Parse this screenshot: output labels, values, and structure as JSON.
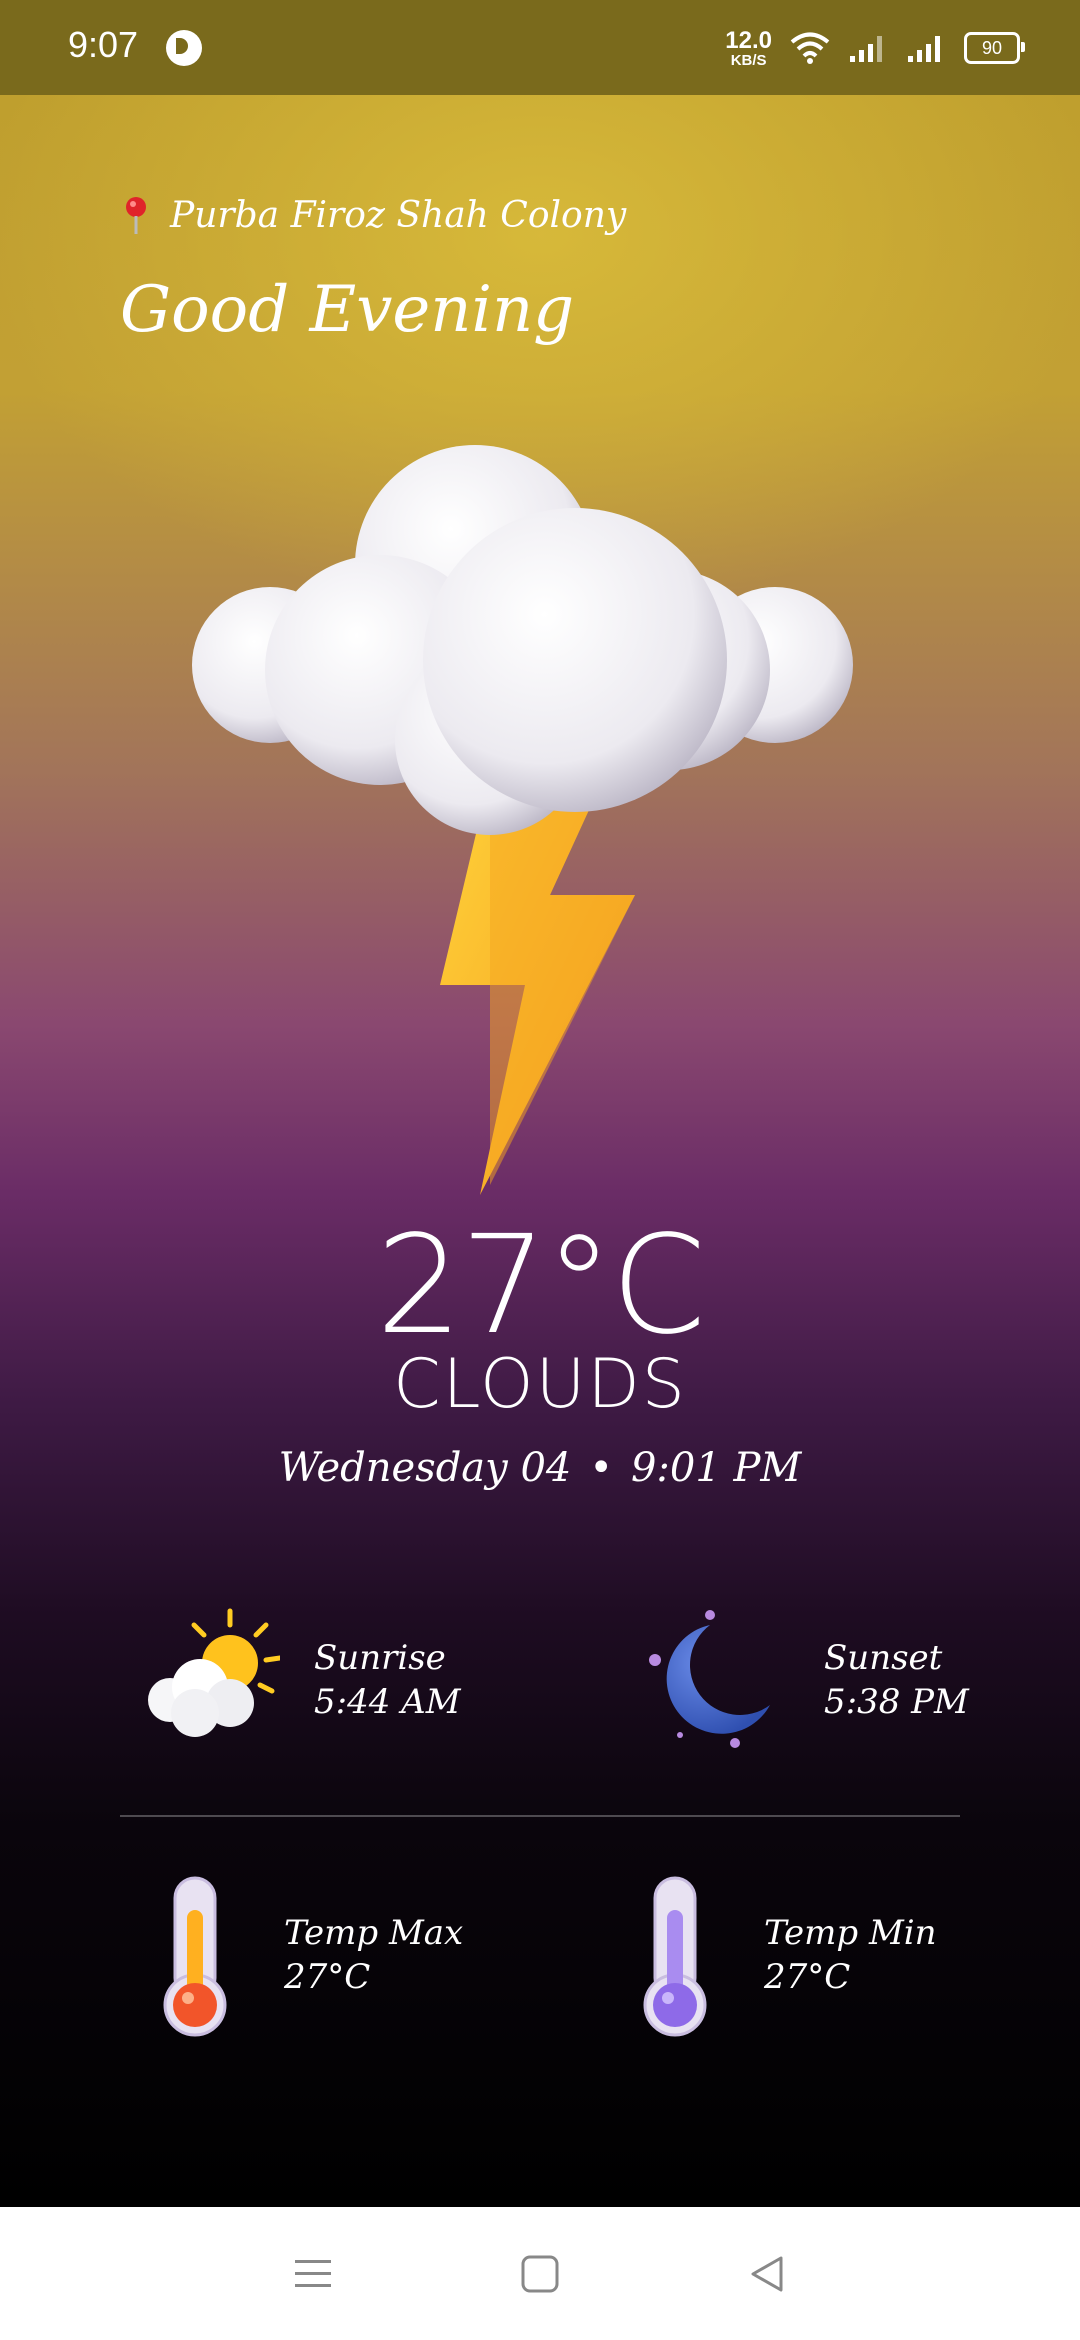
{
  "status_bar": {
    "time": "9:07",
    "net_speed_value": "12.0",
    "net_speed_unit": "KB/S",
    "battery": "90"
  },
  "header": {
    "location": "Purba Firoz Shah Colony",
    "greeting": "Good Evening"
  },
  "current": {
    "temperature": "27°C",
    "condition": "CLOUDS",
    "day": "Wednesday 04",
    "separator": "•",
    "time": "9:01 PM"
  },
  "sun": {
    "sunrise_label": "Sunrise",
    "sunrise_time": "5:44 AM",
    "sunset_label": "Sunset",
    "sunset_time": "5:38 PM"
  },
  "temps": {
    "max_label": "Temp Max",
    "max_value": "27°C",
    "min_label": "Temp Min",
    "min_value": "27°C"
  },
  "icons": {
    "weather": "thunder-cloud-icon",
    "sunrise": "sun-cloud-icon",
    "sunset": "moon-icon",
    "temp_max": "thermometer-hot-icon",
    "temp_min": "thermometer-cold-icon",
    "location": "location-pin-icon"
  },
  "colors": {
    "top_gradient": "#c2a034",
    "mid_gradient": "#6a2c66",
    "bottom_gradient": "#000000",
    "status_bar": "#7a6a1c"
  },
  "nav": {
    "menu": "menu-icon",
    "home": "home-square-icon",
    "back": "back-triangle-icon"
  }
}
